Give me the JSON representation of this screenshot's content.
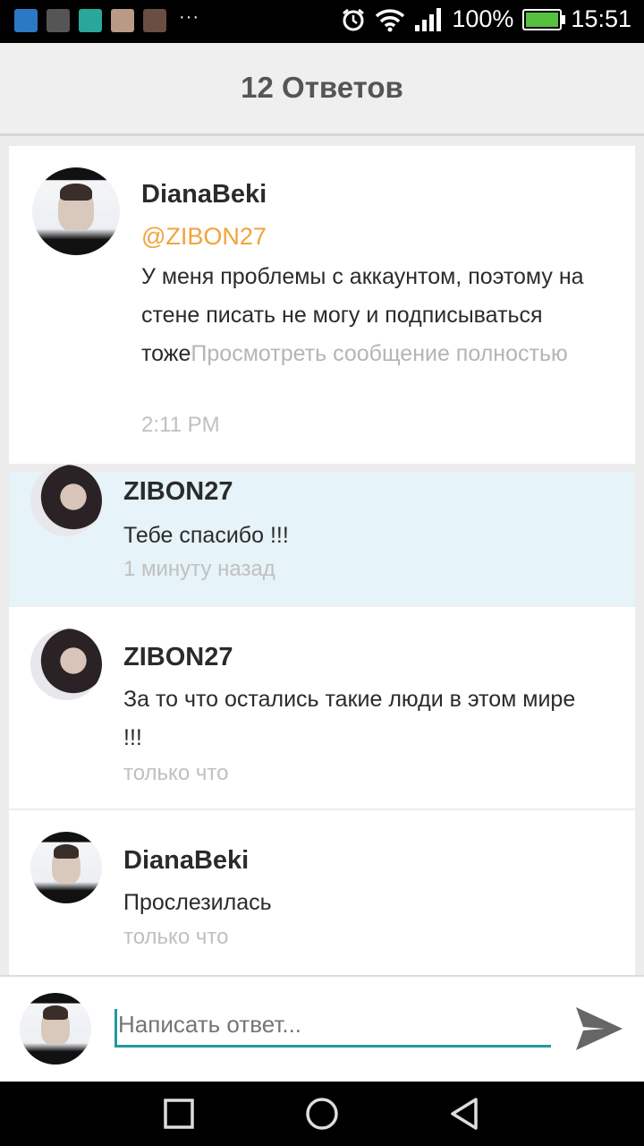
{
  "status_bar": {
    "app_icons": [
      "app-icon-1",
      "app-icon-2",
      "app-icon-3",
      "app-icon-4",
      "app-icon-5"
    ],
    "more": "···",
    "battery_percent": "100%",
    "time": "15:51",
    "battery_level": 1.0
  },
  "header": {
    "title": "12 Ответов"
  },
  "main_post": {
    "author": "DianaBeki",
    "mention": "@ZIBON27",
    "text": "У меня проблемы с аккаунтом, поэтому на стене писать не могу и подписываться тоже",
    "more_link": "Просмотреть сообщение полностью",
    "time": "2:11 PM"
  },
  "replies": [
    {
      "author": "ZIBON27",
      "text": "Тебе спасибо !!!",
      "time": "1 минуту назад"
    },
    {
      "author": "ZIBON27",
      "text": "За то что остались такие люди в этом мире !!!",
      "time": "только что"
    },
    {
      "author": "DianaBeki",
      "text": "Прослезилась",
      "time": "только что"
    }
  ],
  "composer": {
    "placeholder": "Написать ответ..."
  },
  "colors": {
    "accent": "#1f9aa0",
    "mention": "#f2a33a",
    "highlight": "#e6f3f8"
  }
}
